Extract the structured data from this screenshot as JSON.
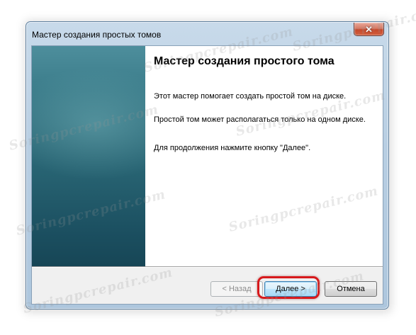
{
  "window": {
    "title": "Мастер создания простых томов",
    "close_glyph": "✕"
  },
  "wizard": {
    "heading": "Мастер создания простого тома",
    "paragraph1": "Этот мастер помогает создать простой том на диске.",
    "paragraph2": "Простой том может располагаться только на одном диске.",
    "paragraph3": "Для продолжения нажмите кнопку \"Далее\"."
  },
  "buttons": {
    "back_label": "< Назад",
    "next_label": "Далее >",
    "cancel_label": "Отмена"
  },
  "watermark": {
    "text": "Soringpcrepair.com"
  },
  "colors": {
    "highlight": "#d7191c",
    "banner": "#286473"
  }
}
